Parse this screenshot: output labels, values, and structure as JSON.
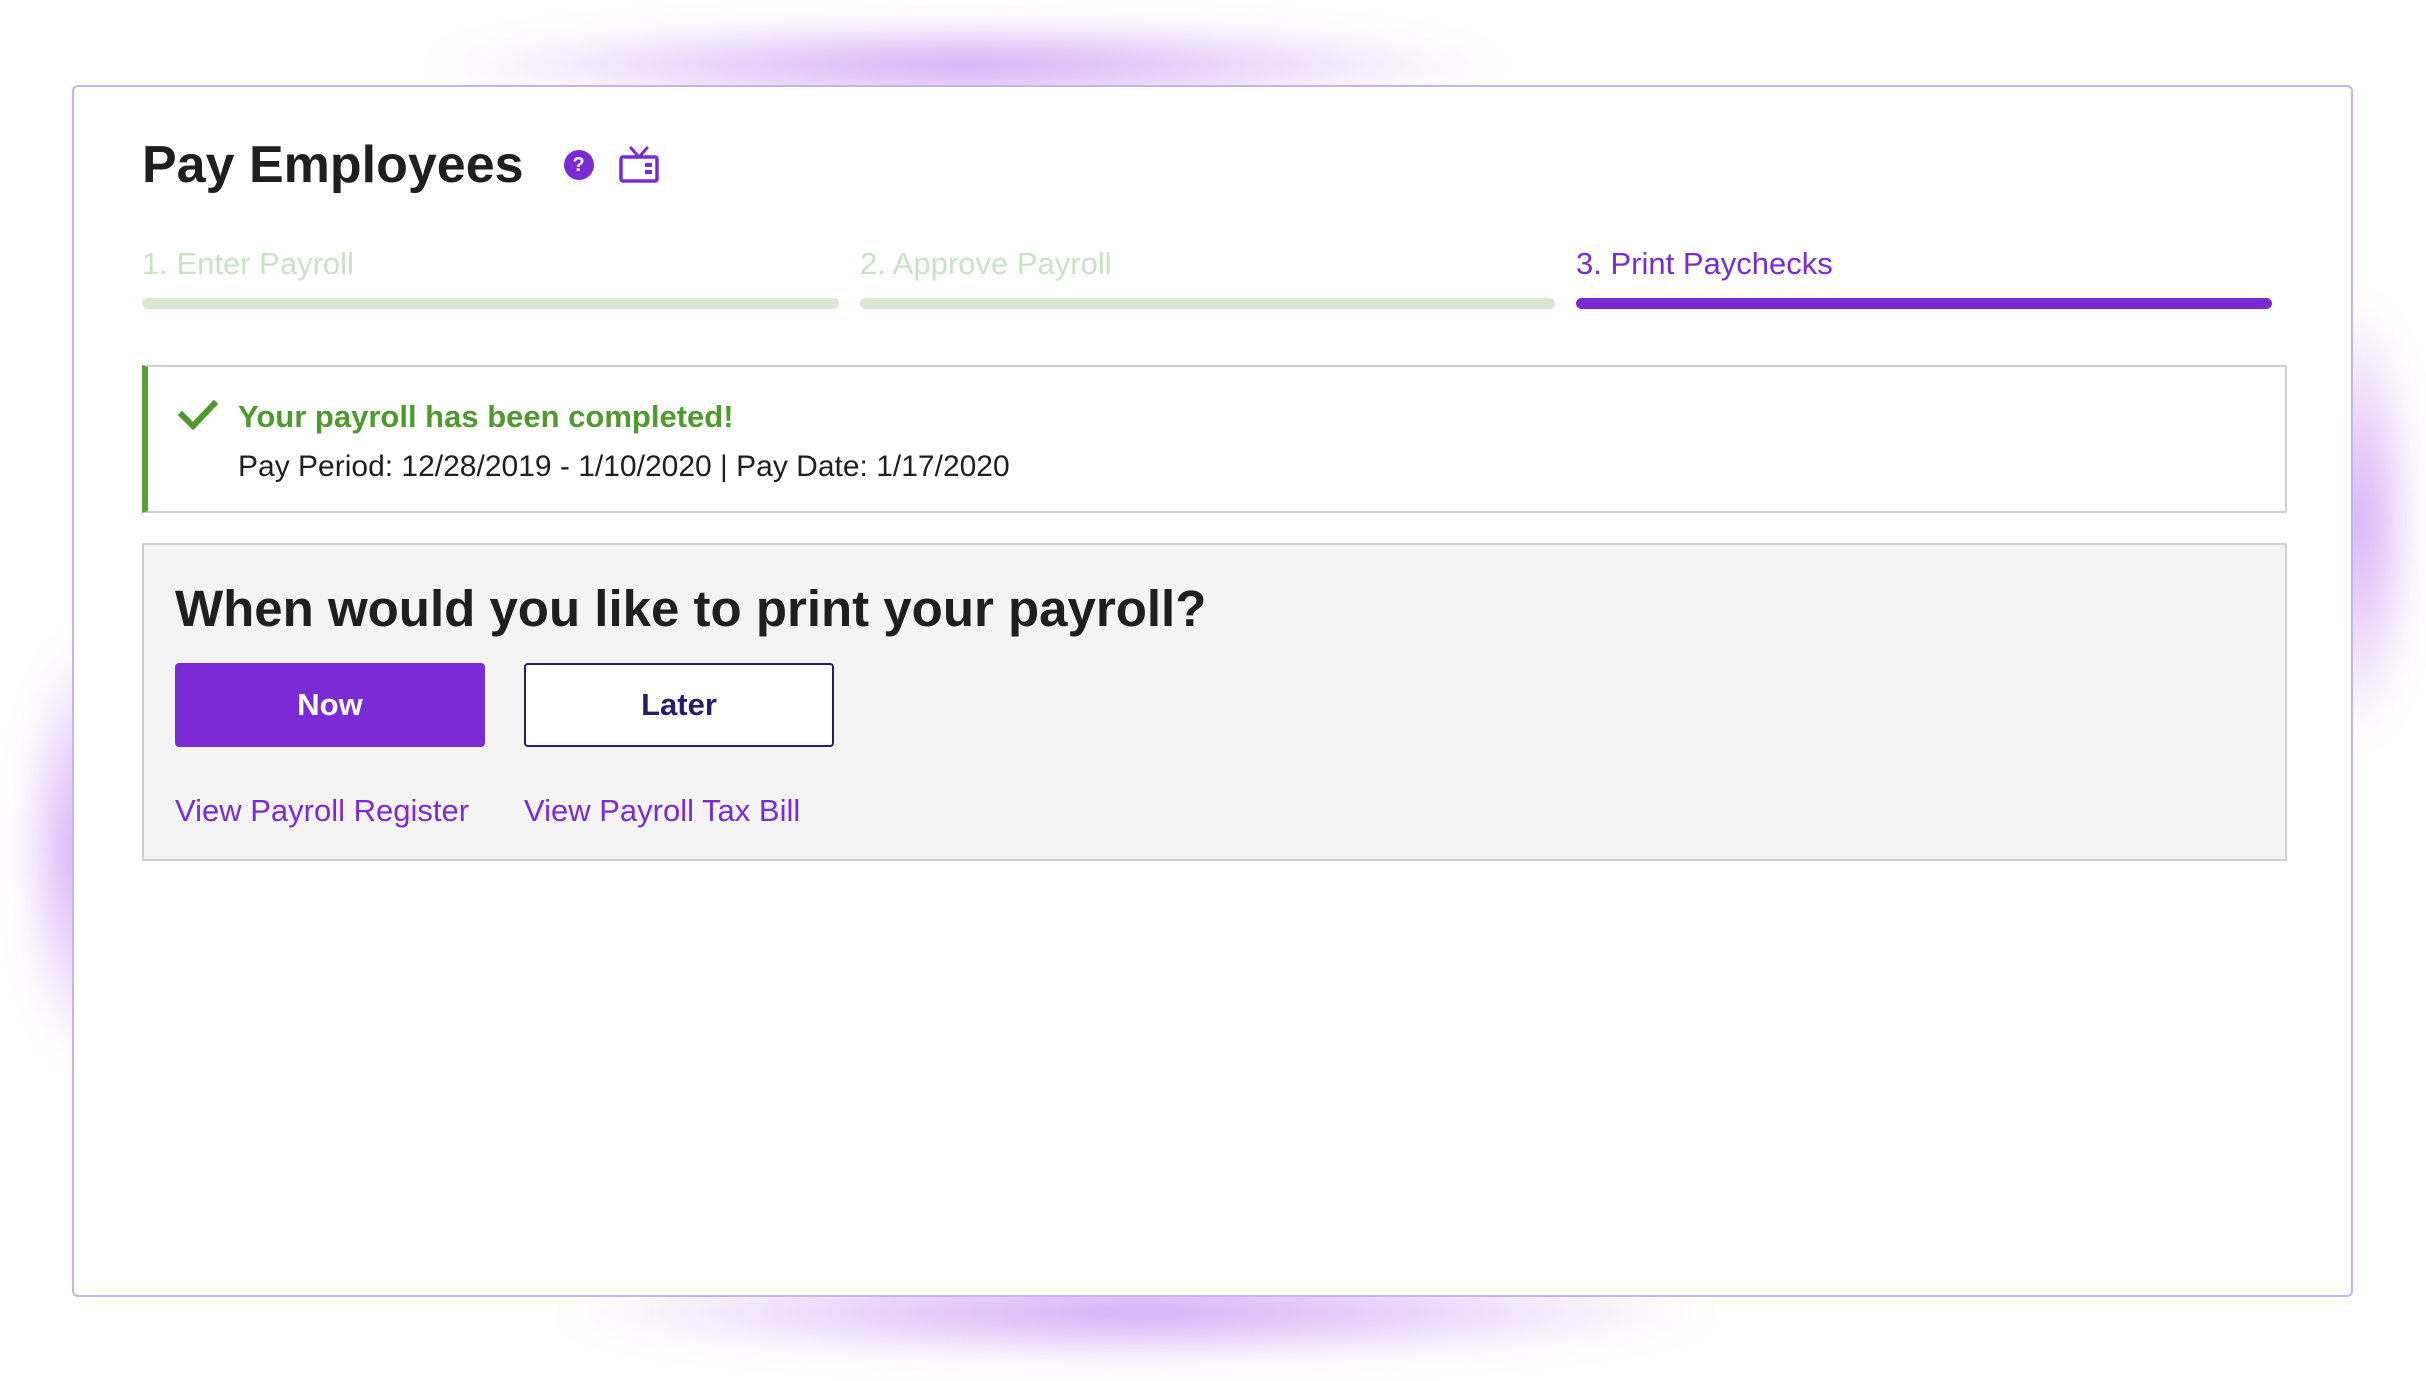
{
  "page": {
    "title": "Pay Employees",
    "help_icon_glyph": "?",
    "icons": {
      "help": "help-circle-icon",
      "video": "tv-video-icon"
    }
  },
  "steps": [
    {
      "label": "1. Enter Payroll",
      "status": "completed"
    },
    {
      "label": "2. Approve Payroll",
      "status": "completed"
    },
    {
      "label": "3. Print Paychecks",
      "status": "current"
    }
  ],
  "alert": {
    "icon": "check-icon",
    "title": "Your payroll has been completed!",
    "details": "Pay Period: 12/28/2019 - 1/10/2020 | Pay Date: 1/17/2020"
  },
  "print": {
    "question": "When would you like to print your payroll?",
    "now_label": "Now",
    "later_label": "Later",
    "register_link": "View Payroll Register",
    "tax_bill_link": "View Payroll Tax Bill"
  },
  "colors": {
    "accent": "#7b2bd6",
    "success": "#4f9a2e",
    "completed_step": "#d6e8d2",
    "later_button": "#2a1a6e"
  }
}
